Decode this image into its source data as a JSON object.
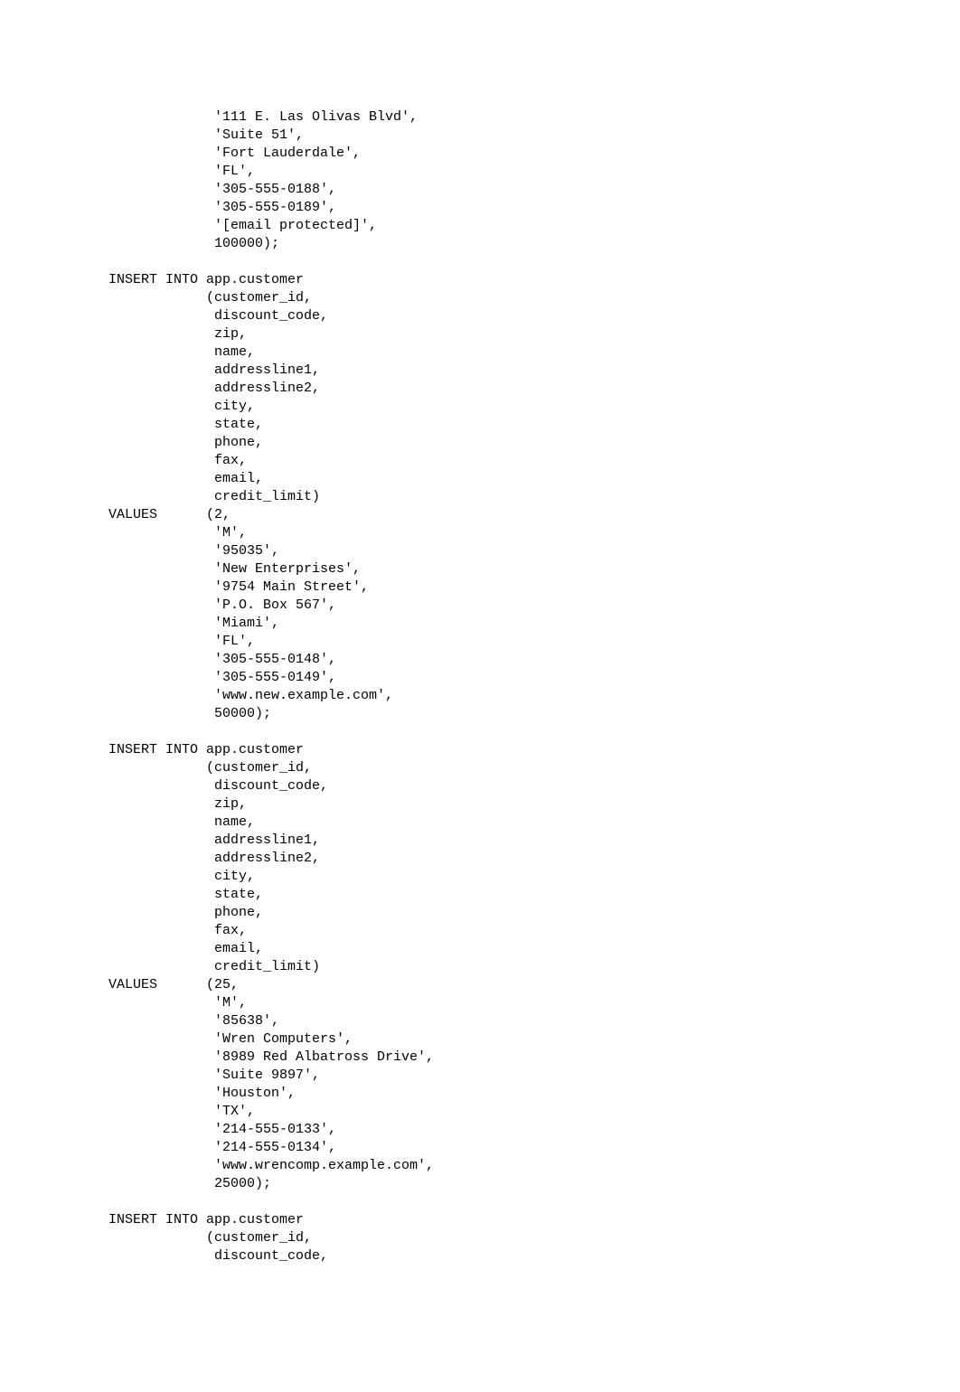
{
  "code_lines": [
    "             '111 E. Las Olivas Blvd',",
    "             'Suite 51',",
    "             'Fort Lauderdale',",
    "             'FL',",
    "             '305-555-0188',",
    "             '305-555-0189',",
    "             '[email protected]',",
    "             100000);",
    "",
    "INSERT INTO app.customer",
    "            (customer_id,",
    "             discount_code,",
    "             zip,",
    "             name,",
    "             addressline1,",
    "             addressline2,",
    "             city,",
    "             state,",
    "             phone,",
    "             fax,",
    "             email,",
    "             credit_limit)",
    "VALUES      (2,",
    "             'M',",
    "             '95035',",
    "             'New Enterprises',",
    "             '9754 Main Street',",
    "             'P.O. Box 567',",
    "             'Miami',",
    "             'FL',",
    "             '305-555-0148',",
    "             '305-555-0149',",
    "             'www.new.example.com',",
    "             50000);",
    "",
    "INSERT INTO app.customer",
    "            (customer_id,",
    "             discount_code,",
    "             zip,",
    "             name,",
    "             addressline1,",
    "             addressline2,",
    "             city,",
    "             state,",
    "             phone,",
    "             fax,",
    "             email,",
    "             credit_limit)",
    "VALUES      (25,",
    "             'M',",
    "             '85638',",
    "             'Wren Computers',",
    "             '8989 Red Albatross Drive',",
    "             'Suite 9897',",
    "             'Houston',",
    "             'TX',",
    "             '214-555-0133',",
    "             '214-555-0134',",
    "             'www.wrencomp.example.com',",
    "             25000);",
    "",
    "INSERT INTO app.customer",
    "            (customer_id,",
    "             discount_code,"
  ]
}
